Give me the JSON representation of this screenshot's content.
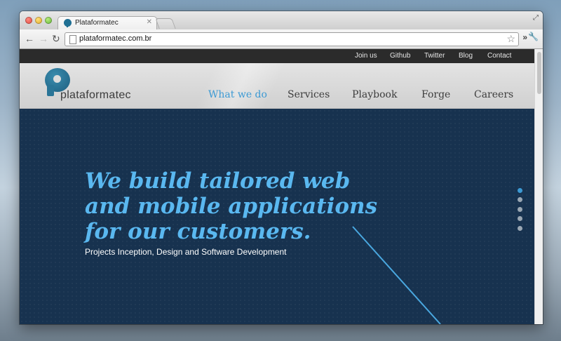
{
  "browser": {
    "tab_title": "Plataformatec",
    "url": "plataformatec.com.br"
  },
  "site": {
    "top_links": [
      {
        "label": "Join us"
      },
      {
        "label": "Github"
      },
      {
        "label": "Twitter"
      },
      {
        "label": "Blog"
      },
      {
        "label": "Contact"
      }
    ],
    "logo_text": "plataformatec",
    "nav": [
      {
        "label": "What we do",
        "active": true
      },
      {
        "label": "Services",
        "active": false
      },
      {
        "label": "Playbook",
        "active": false
      },
      {
        "label": "Forge",
        "active": false
      },
      {
        "label": "Careers",
        "active": false
      }
    ],
    "hero": {
      "title_lines": [
        "We build tailored web",
        "and mobile applications",
        "for our customers."
      ],
      "subtitle": "Projects Inception, Design and Software Development"
    },
    "slider": {
      "count": 5,
      "active_index": 0
    }
  },
  "colors": {
    "accent": "#3c9ad4",
    "hero_title": "#5ab8f0",
    "hero_bg": "#17324f",
    "topbar_bg": "#2b2b2b"
  }
}
